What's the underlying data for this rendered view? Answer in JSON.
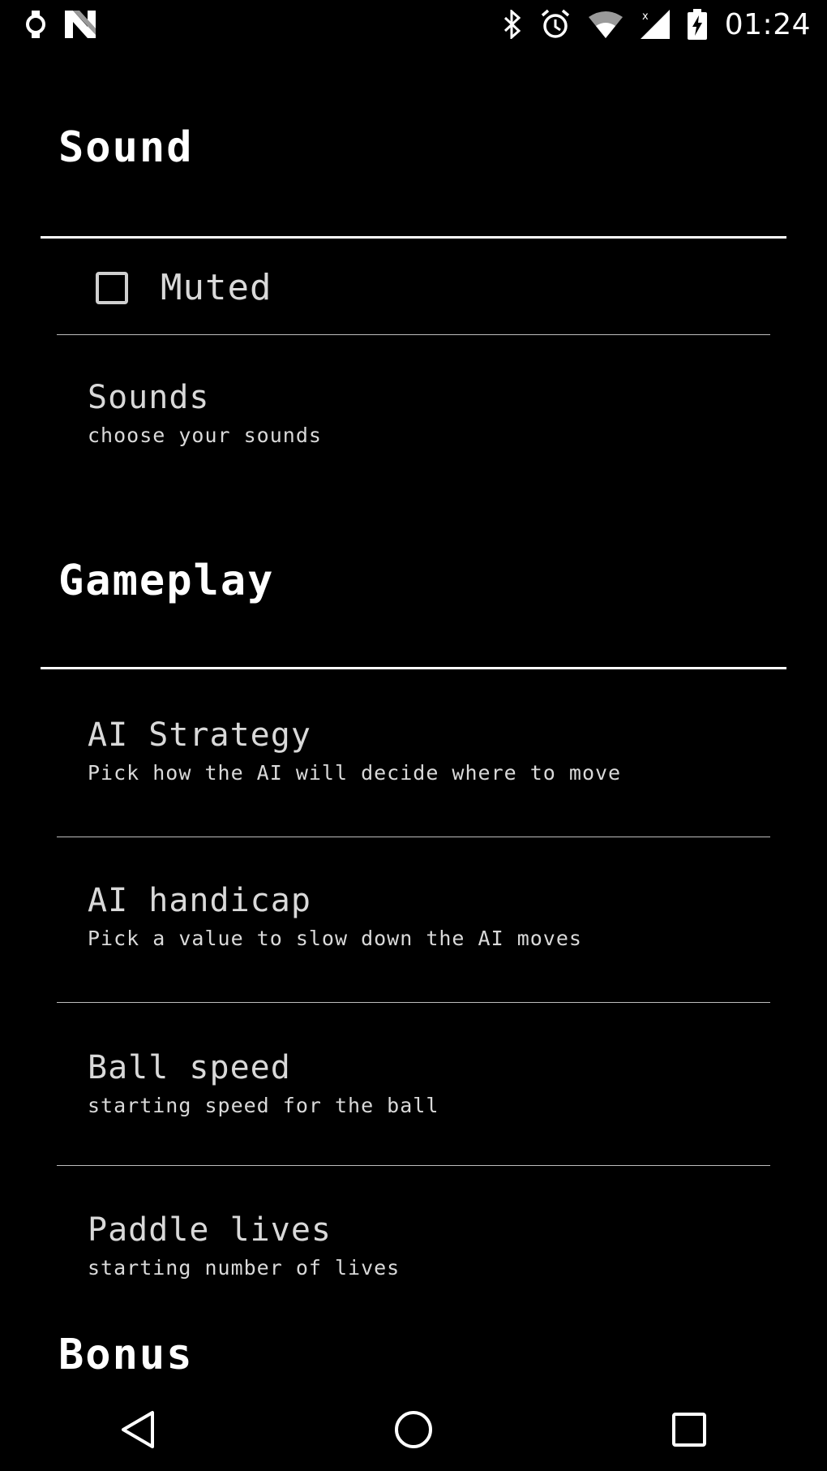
{
  "status_bar": {
    "time": "01:24",
    "left_icons": [
      "watch-icon",
      "n-logo-icon"
    ],
    "right_icons": [
      "bluetooth-icon",
      "alarm-icon",
      "wifi-icon",
      "signal-icon",
      "battery-icon"
    ]
  },
  "sections": {
    "sound": {
      "title": "Sound",
      "muted": {
        "label": "Muted",
        "checked": false
      },
      "sounds": {
        "title": "Sounds",
        "summary": "choose your sounds"
      }
    },
    "gameplay": {
      "title": "Gameplay",
      "items": [
        {
          "title": "AI Strategy",
          "summary": "Pick how the AI will decide where to move"
        },
        {
          "title": "AI handicap",
          "summary": "Pick a value to slow down the AI moves"
        },
        {
          "title": "Ball speed",
          "summary": "starting speed for the ball"
        },
        {
          "title": "Paddle lives",
          "summary": "starting number of lives"
        }
      ]
    },
    "bonus": {
      "title": "Bonus"
    }
  },
  "nav_bar": {
    "buttons": [
      "back-icon",
      "home-icon",
      "recents-icon"
    ]
  },
  "colors": {
    "background": "#000000",
    "text": "#d9d9d9",
    "header_text": "#ffffff",
    "divider": "#bdbdbd"
  }
}
